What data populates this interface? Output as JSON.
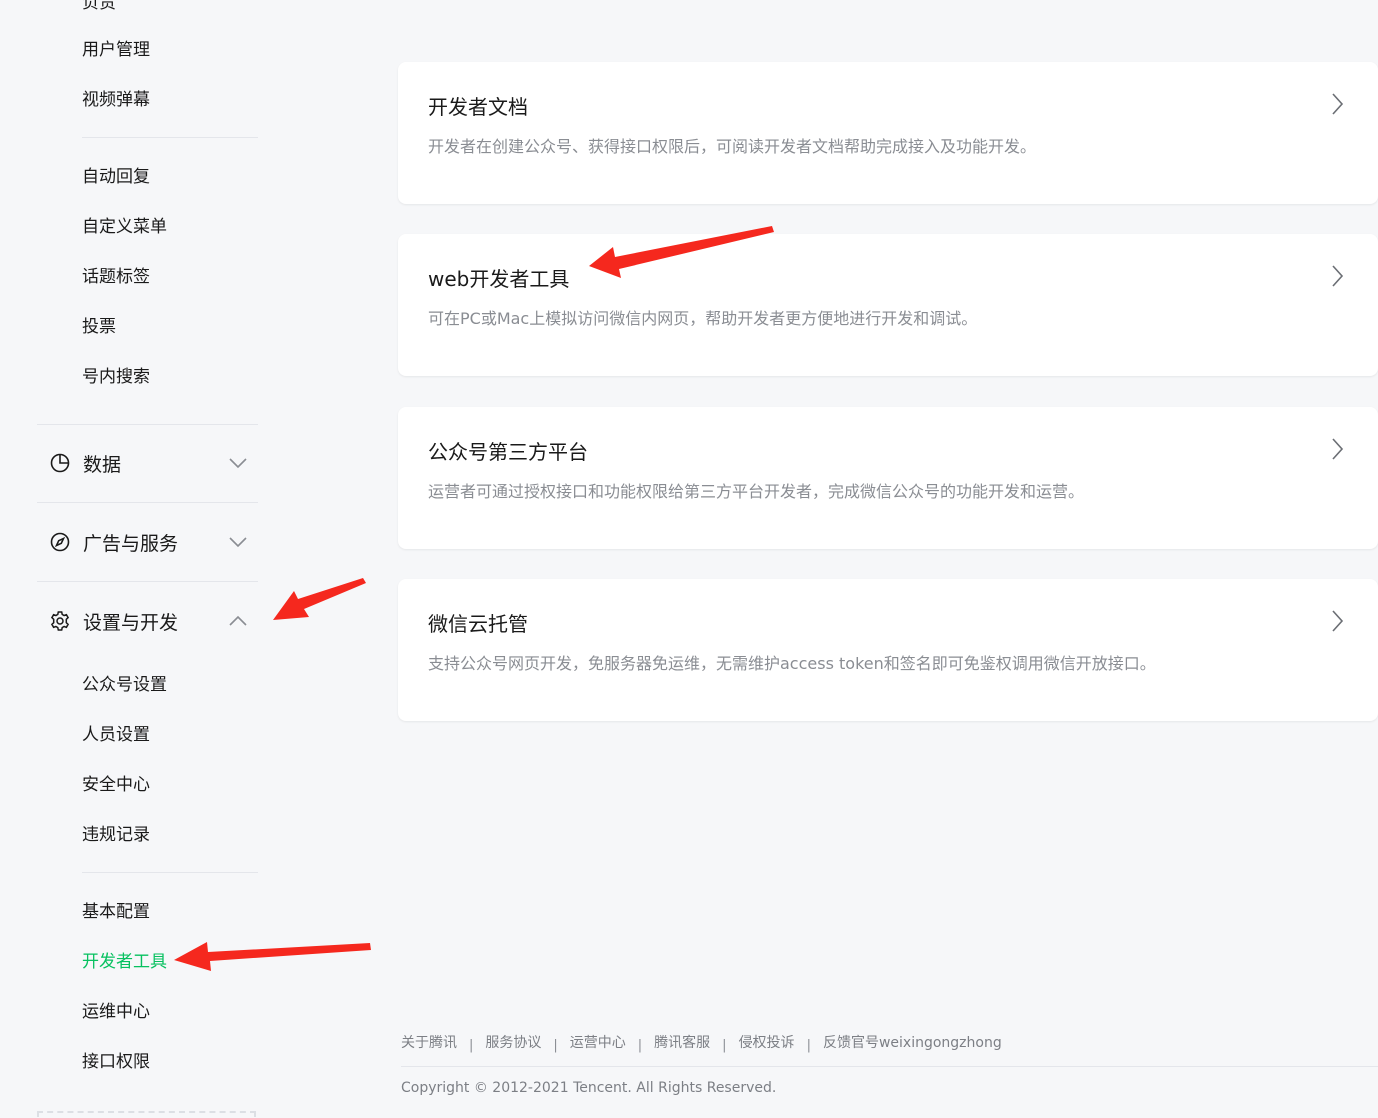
{
  "sidebar": {
    "cutoff_label": "负责",
    "group_top": [
      "用户管理",
      "视频弹幕"
    ],
    "group_interact": [
      "自动回复",
      "自定义菜单",
      "话题标签",
      "投票",
      "号内搜索"
    ],
    "sections": {
      "data": "数据",
      "ads": "广告与服务",
      "settings": "设置与开发"
    },
    "settings_items": [
      "公众号设置",
      "人员设置",
      "安全中心",
      "违规记录"
    ],
    "dev_items": [
      "基本配置",
      "开发者工具",
      "运维中心",
      "接口权限"
    ]
  },
  "cards": [
    {
      "title": "开发者文档",
      "desc": "开发者在创建公众号、获得接口权限后，可阅读开发者文档帮助完成接入及功能开发。"
    },
    {
      "title": "web开发者工具",
      "desc": "可在PC或Mac上模拟访问微信内网页，帮助开发者更方便地进行开发和调试。"
    },
    {
      "title": "公众号第三方平台",
      "desc": "运营者可通过授权接口和功能权限给第三方平台开发者，完成微信公众号的功能开发和运营。"
    },
    {
      "title": "微信云托管",
      "desc": "支持公众号网页开发，免服务器免运维，无需维护access token和签名即可免鉴权调用微信开放接口。"
    }
  ],
  "footer": {
    "links": [
      "关于腾讯",
      "服务协议",
      "运营中心",
      "腾讯客服",
      "侵权投诉",
      "反馈官号weixingongzhong"
    ],
    "separator": "|",
    "copyright": "Copyright © 2012-2021 Tencent. All Rights Reserved."
  },
  "colors": {
    "active": "#07c160",
    "annotation": "#f5281e",
    "background": "#f6f7f9"
  },
  "icons": {
    "data": "pie-chart-icon",
    "ads": "compass-icon",
    "settings": "gear-icon",
    "card_arrow": "chevron-right-icon"
  }
}
